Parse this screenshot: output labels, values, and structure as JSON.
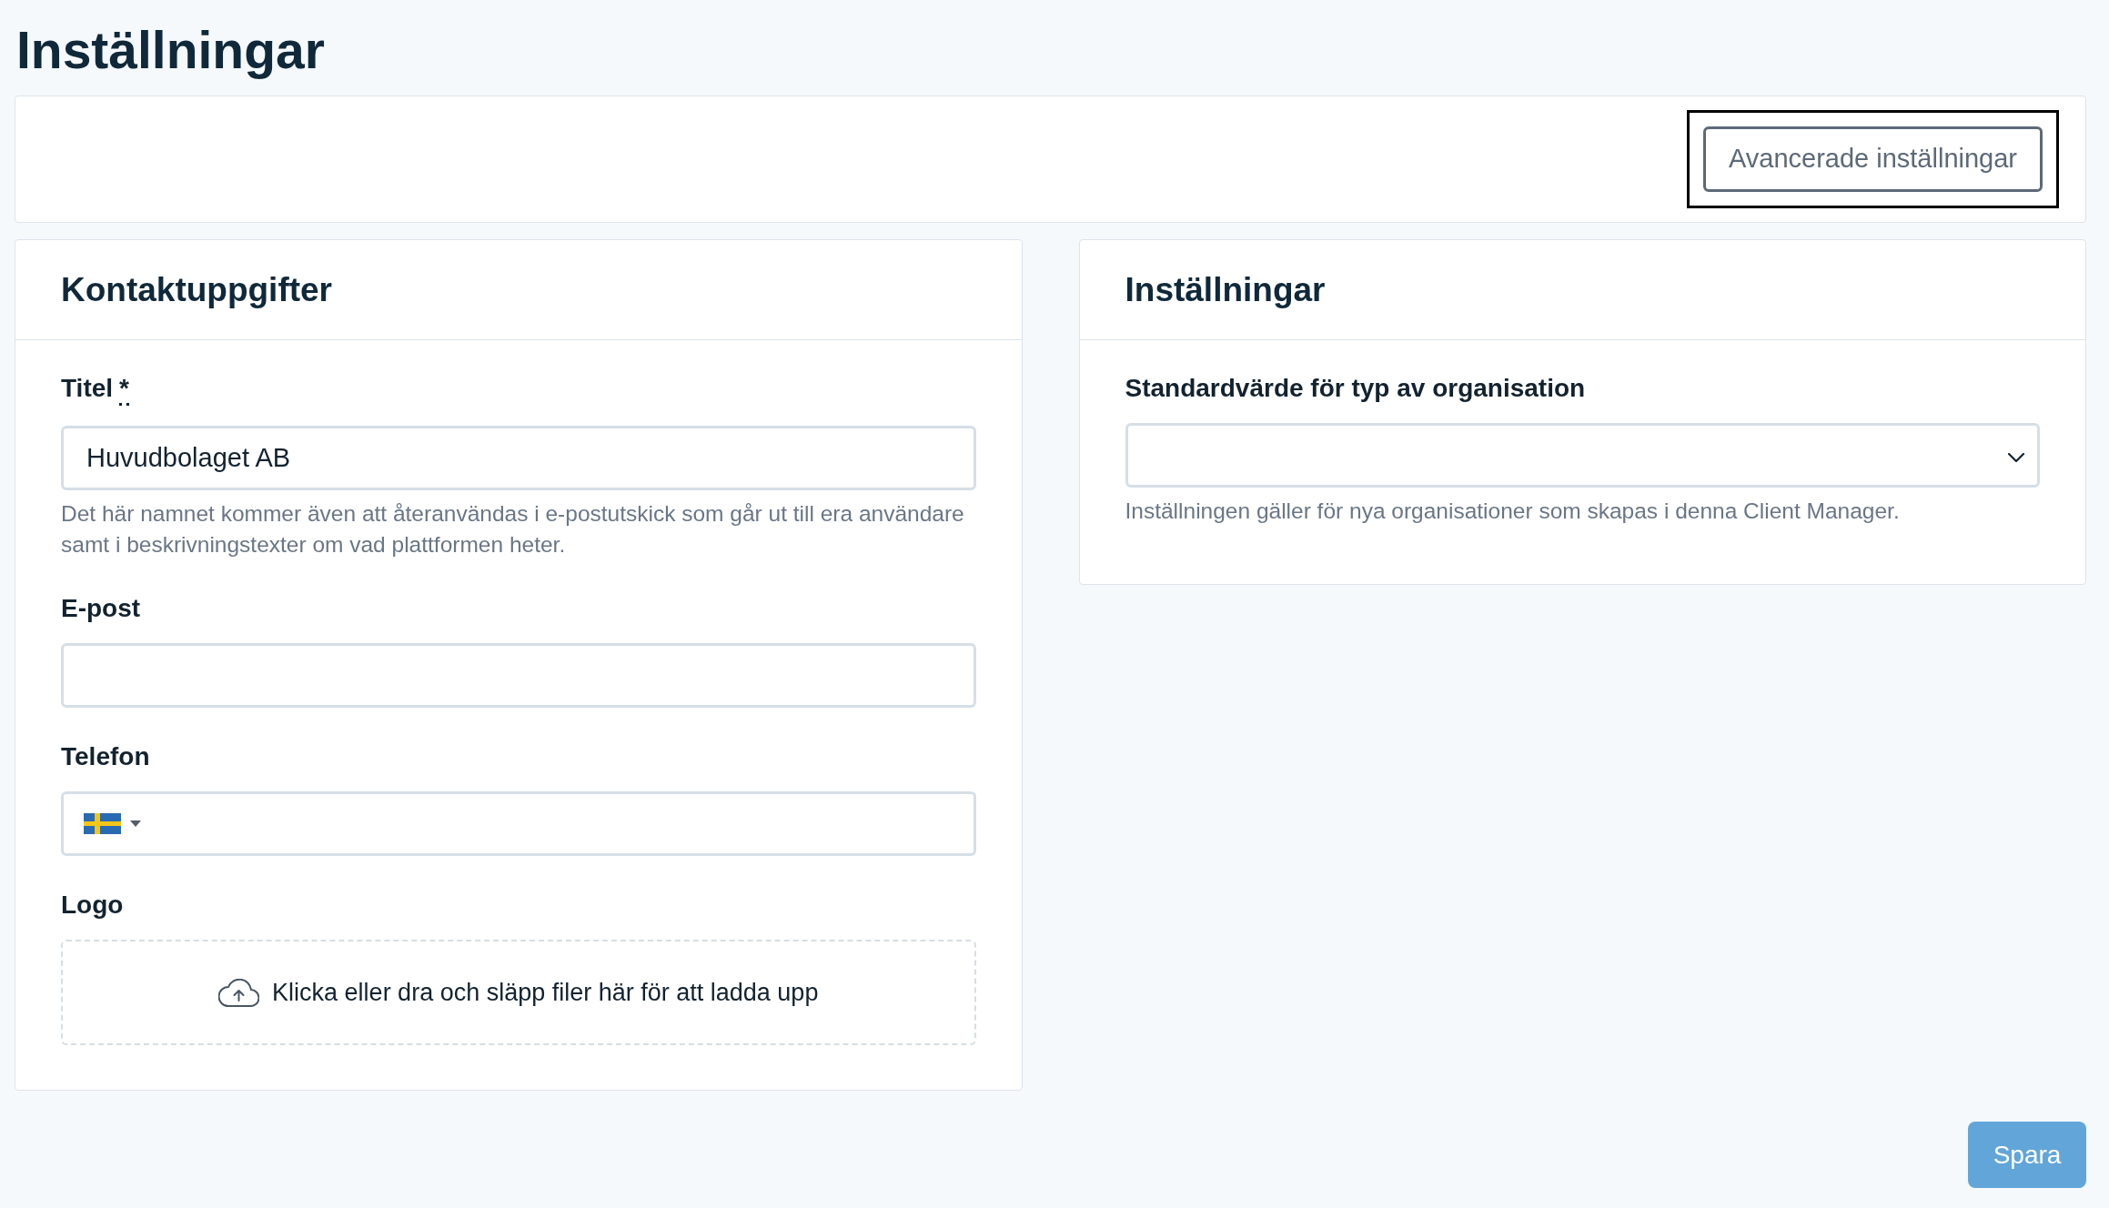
{
  "page_title": "Inställningar",
  "toolbar": {
    "advanced_button": {
      "label": "Avancerade inställningar",
      "focused": true
    }
  },
  "panels": [
    {
      "title": "Kontaktuppgifter",
      "fields": [
        {
          "kind": "text",
          "label": "Titel",
          "required_mark": "*",
          "value": "Huvudbolaget AB",
          "help": "Det här namnet kommer även att återanvändas i e-postutskick som går ut till era användare samt i beskrivningstexter om vad plattformen heter."
        },
        {
          "kind": "text",
          "label": "E-post"
        },
        {
          "kind": "phone",
          "label": "Telefon"
        },
        {
          "kind": "upload",
          "label": "Logo",
          "prompt": "Klicka eller dra och släpp filer här för att ladda upp"
        }
      ]
    },
    {
      "title": "Inställningar",
      "fields": [
        {
          "kind": "select",
          "label": "Standardvärde för typ av organisation",
          "help": "Inställningen gäller för nya organisationer som skapas i denna Client Manager."
        }
      ]
    }
  ],
  "save_button": {
    "label": "Spara"
  }
}
